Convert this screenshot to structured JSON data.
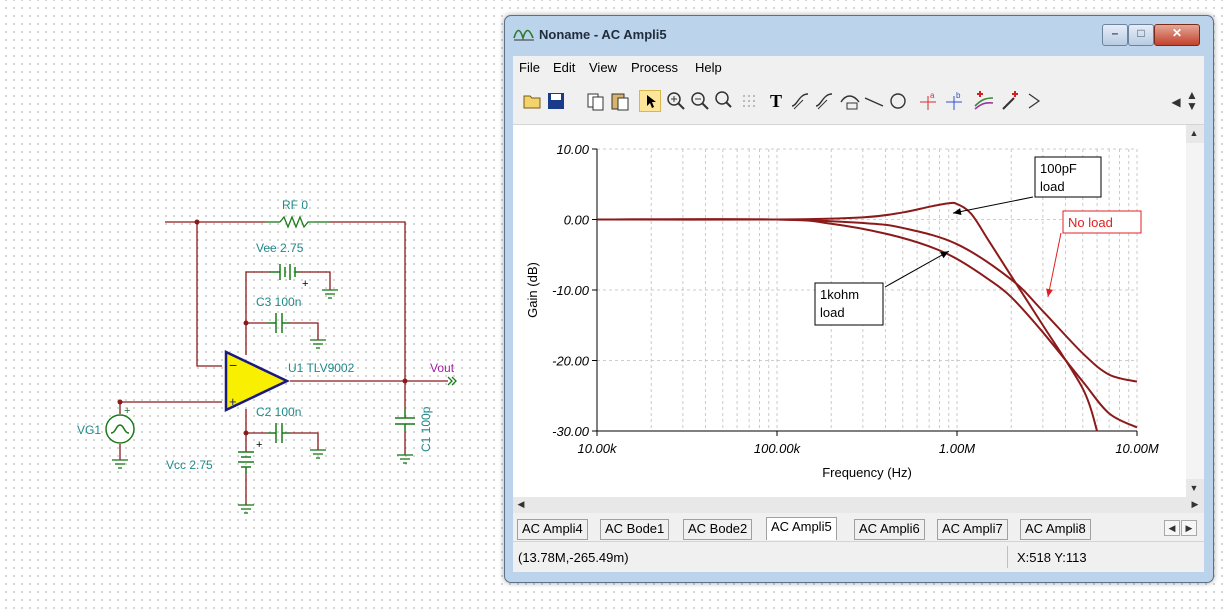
{
  "schematic": {
    "rf_label": "RF 0",
    "vee_label": "Vee 2.75",
    "c3_label": "C3 100n",
    "u1_label": "U1 TLV9002",
    "vout_label": "Vout",
    "c2_label": "C2 100n",
    "vg1_label": "VG1",
    "vcc_label": "Vcc 2.75",
    "c1_label": "C1 100p",
    "minus_sign": "−",
    "plus_sign": "+"
  },
  "window": {
    "title": "Noname - AC Ampli5",
    "controls": {
      "minimize": "–",
      "maximize": "□",
      "close": "✕"
    }
  },
  "menu": [
    "File",
    "Edit",
    "View",
    "Process",
    "Help"
  ],
  "toolbar": {
    "icons": [
      "open-folder-icon",
      "save-icon",
      "copy-icon",
      "paste-icon",
      "pointer-icon",
      "zoom-in-icon",
      "zoom-out-icon",
      "zoom-100-icon",
      "grid-icon",
      "text-icon",
      "curve-label-icon",
      "curve-label-2-icon",
      "dimension-icon",
      "line-icon",
      "circle-icon",
      "cursor-a-icon",
      "cursor-b-icon",
      "add-curve-icon",
      "add-marker-icon",
      "arrow-flag-icon"
    ],
    "a_label": "a",
    "b_label": "b",
    "text_glyph": "T"
  },
  "chart_data": {
    "type": "line",
    "xlabel": "Frequency (Hz)",
    "ylabel": "Gain (dB)",
    "x_scale": "log",
    "xlim": [
      10000,
      10000000
    ],
    "ylim": [
      -30,
      10
    ],
    "x_ticks": [
      "10.00k",
      "100.00k",
      "1.00M",
      "10.00M"
    ],
    "y_ticks": [
      "10.00",
      "0.00",
      "-10.00",
      "-20.00",
      "-30.00"
    ],
    "grid": true,
    "color": "#8b1a1a",
    "series": [
      {
        "name": "No load",
        "x": [
          10000,
          100000,
          300000,
          500000,
          1000000,
          2000000,
          3000000,
          5000000,
          7000000,
          10000000
        ],
        "y": [
          0,
          0,
          -0.5,
          -1.2,
          -3.5,
          -8.5,
          -13,
          -19,
          -22,
          -23
        ]
      },
      {
        "name": "100pF load",
        "x": [
          10000,
          100000,
          300000,
          500000,
          700000,
          900000,
          1000000,
          1200000,
          1500000,
          2000000,
          3000000,
          5000000,
          6000000
        ],
        "y": [
          0,
          0,
          0.3,
          1.0,
          1.8,
          2.3,
          2.2,
          0.8,
          -3,
          -8,
          -15,
          -24,
          -30
        ]
      },
      {
        "name": "1kohm load",
        "x": [
          10000,
          100000,
          200000,
          400000,
          700000,
          1000000,
          1500000,
          2000000,
          3000000,
          5000000,
          7000000,
          10000000
        ],
        "y": [
          0,
          0,
          -0.6,
          -2,
          -3.8,
          -5.6,
          -8.5,
          -11,
          -16,
          -23,
          -27.5,
          -29.5
        ]
      }
    ],
    "annotations": [
      {
        "text_lines": [
          "100pF",
          "load"
        ],
        "box": "black"
      },
      {
        "text_lines": [
          "No load"
        ],
        "box": "red"
      },
      {
        "text_lines": [
          "1kohm",
          "load"
        ],
        "box": "black"
      }
    ]
  },
  "tabs": [
    {
      "label": "AC Ampli4",
      "active": false
    },
    {
      "label": "AC Bode1",
      "active": false
    },
    {
      "label": "AC Bode2",
      "active": false
    },
    {
      "label": "AC Ampli5",
      "active": true
    },
    {
      "label": "AC Ampli6",
      "active": false
    },
    {
      "label": "AC Ampli7",
      "active": false
    },
    {
      "label": "AC Ampli8",
      "active": false
    }
  ],
  "status": {
    "cursor_value": "(13.78M,-265.49m)",
    "coords": "X:518  Y:113"
  }
}
